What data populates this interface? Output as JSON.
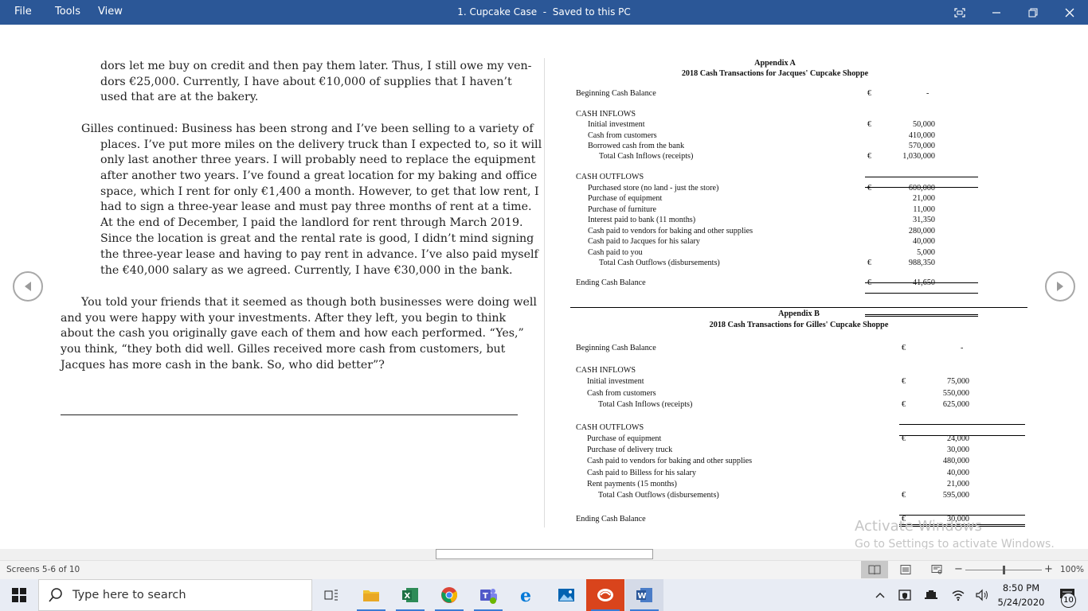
{
  "titlebar": {
    "menu": [
      "File",
      "Tools",
      "View"
    ],
    "document_title": "1. Cupcake Case",
    "separator": "-",
    "save_status": "Saved to this PC"
  },
  "left_page": {
    "para1_lines": [
      "dors let me buy on credit and then pay them later. Thus, I still owe my ven-",
      "dors €25,000. Currently, I have about €10,000 of supplies that I haven’t",
      "used that are at the bakery."
    ],
    "para2_lines": [
      "Gilles continued: Business has been strong and I’ve been selling to a variety of",
      "places. I’ve put more miles on the delivery truck than I expected to, so it will",
      "only last another three years. I will probably need to replace the equipment",
      "after another two years. I’ve found a great location for my baking and office",
      "space, which I rent for only €1,400 a month. However, to get that low rent, I",
      "had to sign a three-year lease and must pay three months of rent at a time.",
      "At the end of December, I paid the landlord for rent through March 2019.",
      "Since the location is great and the rental rate is good, I didn’t mind signing",
      "the three-year lease and having to pay rent in advance. I’ve also paid myself",
      "the €40,000 salary as we agreed. Currently, I have €30,000 in the bank."
    ],
    "para3_lines": [
      "You told your friends that it seemed as though both businesses were doing well",
      "and you were happy with your investments. After they left, you begin to think",
      "about the cash you originally gave each of them and how each performed. “Yes,”",
      "you think, “they both did well. Gilles received more cash from customers, but",
      "Jacques has more cash in the bank. So, who did better”?"
    ]
  },
  "appendix_a": {
    "title": "Appendix A",
    "subtitle": "2018 Cash Transactions for Jacques' Cupcake Shoppe",
    "beginning_label": "Beginning Cash Balance",
    "beginning_value": "-",
    "currency": "€",
    "inflows_header": "CASH INFLOWS",
    "inflows": [
      {
        "label": "Initial investment",
        "value": "50,000"
      },
      {
        "label": "Cash from customers",
        "value": "410,000"
      },
      {
        "label": "Borrowed cash from the bank",
        "value": "570,000"
      }
    ],
    "inflows_total_label": "Total Cash Inflows (receipts)",
    "inflows_total_value": "1,030,000",
    "outflows_header": "CASH OUTFLOWS",
    "outflows": [
      {
        "label": "Purchased store (no land - just the store)",
        "value": "600,000"
      },
      {
        "label": "Purchase of equipment",
        "value": "21,000"
      },
      {
        "label": "Purchase of furniture",
        "value": "11,000"
      },
      {
        "label": "Interest paid to bank (11 months)",
        "value": "31,350"
      },
      {
        "label": "Cash paid to vendors for baking and other supplies",
        "value": "280,000"
      },
      {
        "label": "Cash paid to Jacques for his salary",
        "value": "40,000"
      },
      {
        "label": "Cash paid to you",
        "value": "5,000"
      }
    ],
    "outflows_total_label": "Total Cash Outflows (disbursements)",
    "outflows_total_value": "988,350",
    "ending_label": "Ending Cash Balance",
    "ending_value": "41,650"
  },
  "appendix_b": {
    "title": "Appendix B",
    "subtitle": "2018 Cash Transactions for Gilles' Cupcake Shoppe",
    "beginning_label": "Beginning Cash Balance",
    "beginning_value": "-",
    "currency": "€",
    "inflows_header": "CASH INFLOWS",
    "inflows": [
      {
        "label": "Initial investment",
        "value": "75,000"
      },
      {
        "label": "Cash from customers",
        "value": "550,000"
      }
    ],
    "inflows_total_label": "Total Cash Inflows (receipts)",
    "inflows_total_value": "625,000",
    "outflows_header": "CASH OUTFLOWS",
    "outflows": [
      {
        "label": "Purchase of equipment",
        "value": "24,000"
      },
      {
        "label": "Purchase of delivery truck",
        "value": "30,000"
      },
      {
        "label": "Cash paid to vendors for baking and other supplies",
        "value": "480,000"
      },
      {
        "label": "Cash paid to Billess for his salary",
        "value": "40,000"
      },
      {
        "label": "Rent payments (15 months)",
        "value": "21,000"
      }
    ],
    "outflows_total_label": "Total Cash Outflows (disbursements)",
    "outflows_total_value": "595,000",
    "ending_label": "Ending Cash Balance",
    "ending_value": "30,000"
  },
  "watermark": {
    "line1": "Activate Windows",
    "line2": "Go to Settings to activate Windows."
  },
  "statusbar": {
    "screens": "Screens 5-6 of 10",
    "zoom": "100%",
    "zoom_fraction": 0.5
  },
  "taskbar": {
    "search_placeholder": "Type here to search",
    "time": "8:50 PM",
    "date": "5/24/2020",
    "notification_count": "10"
  },
  "colors": {
    "titlebar": "#2b5797",
    "taskbar": "#e8ecf4",
    "excel": "#1e7145",
    "word": "#2b579a",
    "teams": "#5059c9",
    "edge": "#0078d7",
    "highlight": "#d9441c"
  }
}
